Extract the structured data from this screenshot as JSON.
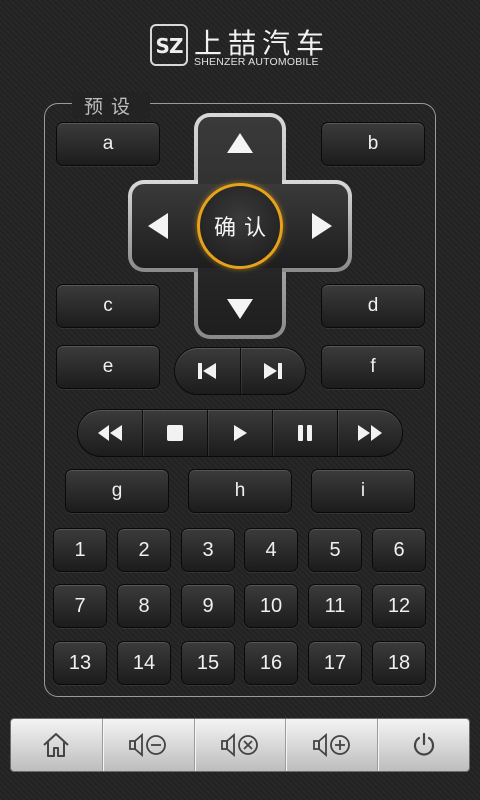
{
  "brand": {
    "mark_text": "SZ",
    "name_cn": "上喆汽车",
    "name_en": "SHENZER AUTOMOBILE"
  },
  "preset_title": "预设",
  "dpad": {
    "ok_label": "确认",
    "up_icon": "arrow-up",
    "down_icon": "arrow-down",
    "left_icon": "arrow-left",
    "right_icon": "arrow-right"
  },
  "letter_buttons": {
    "a": "a",
    "b": "b",
    "c": "c",
    "d": "d",
    "e": "e",
    "f": "f",
    "g": "g",
    "h": "h",
    "i": "i"
  },
  "track_buttons": [
    "previous-track-icon",
    "next-track-icon"
  ],
  "transport_buttons": [
    "rewind-icon",
    "stop-icon",
    "play-icon",
    "pause-icon",
    "fast-forward-icon"
  ],
  "numbers": [
    "1",
    "2",
    "3",
    "4",
    "5",
    "6",
    "7",
    "8",
    "9",
    "10",
    "11",
    "12",
    "13",
    "14",
    "15",
    "16",
    "17",
    "18"
  ],
  "bottom_bar": [
    "home-icon",
    "volume-down-icon",
    "mute-icon",
    "volume-up-icon",
    "power-icon"
  ],
  "colors": {
    "accent_ring": "#e6a21a",
    "background": "#232323"
  }
}
